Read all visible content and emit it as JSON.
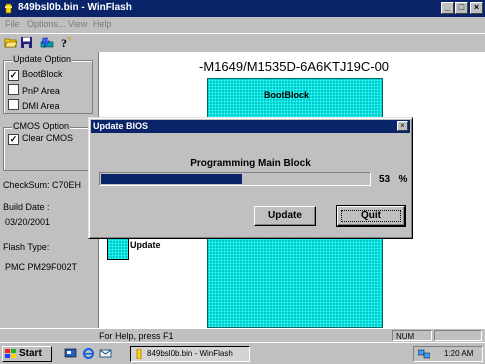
{
  "window": {
    "title": "849bsl0b.bin - WinFlash",
    "minimize": "_",
    "maximize": "□",
    "close": "×"
  },
  "menu": {
    "items": [
      {
        "label": "File"
      },
      {
        "label": "Options..."
      },
      {
        "label": "View"
      },
      {
        "label": "Help"
      }
    ]
  },
  "toolbar": {
    "icons": [
      "open-folder-icon",
      "save-disk-icon",
      "flash-update-icon",
      "help-question-icon"
    ]
  },
  "update_options": {
    "legend": "Update Option",
    "items": [
      {
        "label": "BootBlock",
        "checked": true
      },
      {
        "label": "PnP Area",
        "checked": false
      },
      {
        "label": "DMI Area",
        "checked": false
      }
    ]
  },
  "cmos_options": {
    "legend": "CMOS Option",
    "items": [
      {
        "label": "Clear CMOS",
        "checked": true
      }
    ]
  },
  "info": {
    "checksum": "CheckSum:  C70EH",
    "build_date_label": "Build Date :",
    "build_date": "03/20/2001",
    "flash_type_label": "Flash Type:",
    "flash_type": "PMC PM29F002T"
  },
  "main": {
    "bios_id": "-M1649/M1535D-6A6KTJ19C-00",
    "bootblock_label": "BootBlock",
    "legend_update_label": "Update",
    "block_color": "#00cccc"
  },
  "dialog": {
    "title": "Update BIOS",
    "close": "×",
    "operation": "Programming Main Block",
    "progress_percent": 53,
    "percent_text": "53",
    "percent_sign": "%",
    "update_button": "Update",
    "quit_button": "Quit"
  },
  "statusbar": {
    "message": "For Help, press F1",
    "num": "NUM"
  },
  "taskbar": {
    "start": "Start",
    "task": "849bsl0b.bin - WinFlash",
    "time": "1:20 AM"
  }
}
